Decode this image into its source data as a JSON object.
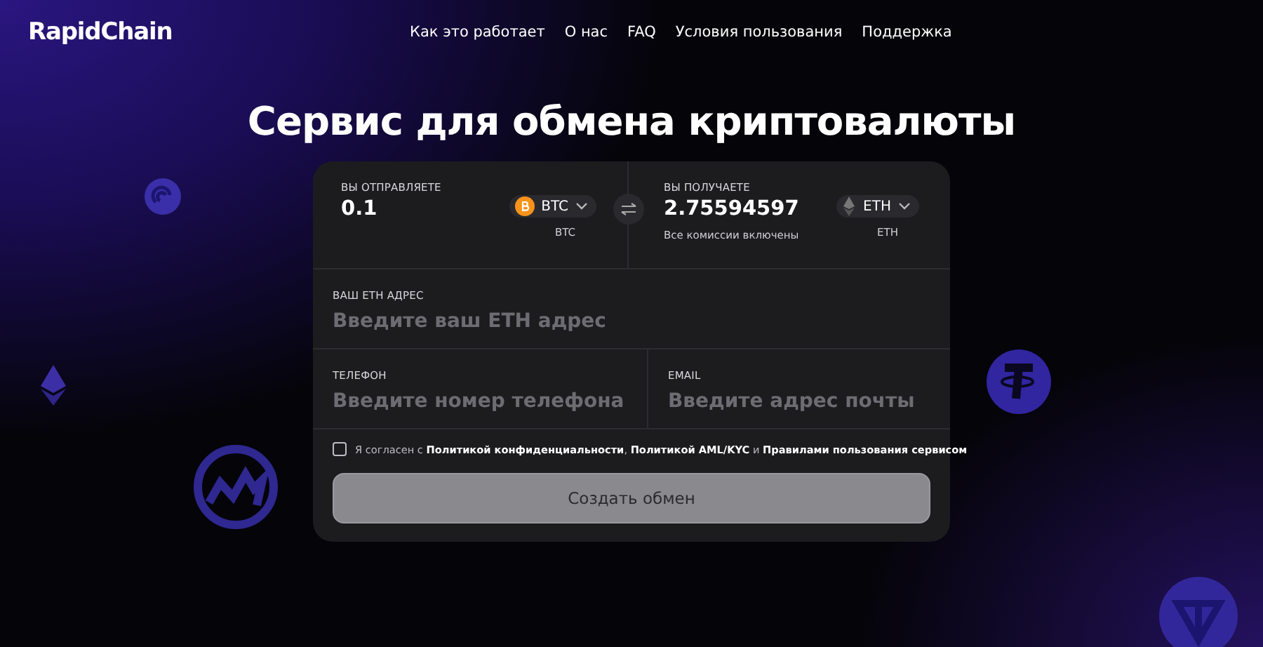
{
  "header": {
    "logo": "RapidChain",
    "nav": [
      "Как это работает",
      "О нас",
      "FAQ",
      "Условия пользования",
      "Поддержка"
    ]
  },
  "title": "Сервис для обмена криптовалюты",
  "exchange": {
    "send": {
      "label": "ВЫ ОТПРАВЛЯЕТЕ",
      "amount": "0.1",
      "currency": "BTC",
      "unit": "BTC"
    },
    "receive": {
      "label": "ВЫ ПОЛУЧАЕТЕ",
      "amount": "2.75594597",
      "note": "Все комиссии включены",
      "currency": "ETH",
      "unit": "ETH"
    }
  },
  "address": {
    "label": "ВАШ ETH АДРЕС",
    "placeholder": "Введите ваш ETH адрес"
  },
  "phone": {
    "label": "ТЕЛЕФОН",
    "placeholder": "Введите номер телефона"
  },
  "email": {
    "label": "EMAIL",
    "placeholder": "Введите адрес почты"
  },
  "agreement": {
    "checked": false,
    "text": "Я согласен с **Политикой конфиденциальности**, **Политикой AML/KYC** и **Правилами пользования сервисом**"
  },
  "submit": {
    "label": "Создать обмен",
    "disabled": true
  }
}
